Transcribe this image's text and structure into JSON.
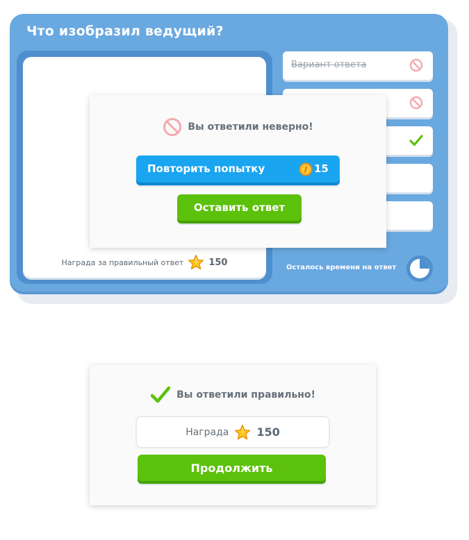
{
  "game": {
    "title": "Что изобразил ведущий?",
    "reward_label": "Награда за правильный ответ",
    "reward_points": "150",
    "timer_label": "Осталось времени на ответ",
    "timer_remaining_fraction": 0.75,
    "answers": [
      {
        "text": "Вариант ответа",
        "state": "blocked",
        "icon": "blocked-icon"
      },
      {
        "text": "",
        "state": "blocked",
        "icon": "blocked-icon"
      },
      {
        "text": "",
        "state": "correct",
        "icon": "checkmark-icon"
      },
      {
        "text": "",
        "state": "empty",
        "icon": ""
      },
      {
        "text": "",
        "state": "empty",
        "icon": ""
      }
    ]
  },
  "wrong_modal": {
    "message": "Вы ответили неверно!",
    "icon": "blocked-icon",
    "retry_label": "Повторить попытку",
    "retry_cost": "15",
    "keep_label": "Оставить ответ"
  },
  "right_modal": {
    "message": "Вы ответили правильно!",
    "icon": "checkmark-icon",
    "reward_label": "Награда",
    "reward_points": "150",
    "continue_label": "Продолжить"
  },
  "colors": {
    "panel": "#6aa8e0",
    "retry_button": "#1aa5f0",
    "primary_green": "#5cc10b",
    "blocked_red": "#f4a9b0",
    "check_green": "#5cc10b"
  }
}
